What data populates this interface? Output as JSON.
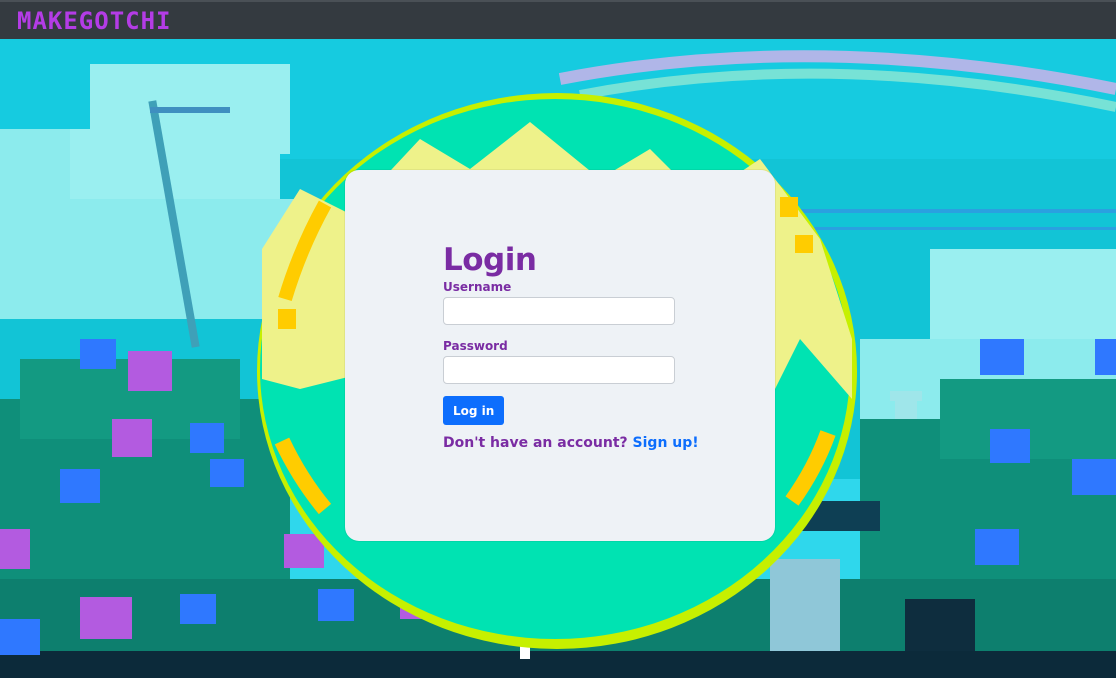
{
  "navbar": {
    "brand": "MAKEGOTCHI"
  },
  "login": {
    "title": "Login",
    "username_label": "Username",
    "username_value": "",
    "password_label": "Password",
    "password_value": "",
    "submit_label": "Log in",
    "signup_prompt": "Don't have an account?",
    "signup_link": "Sign up!"
  },
  "colors": {
    "brand": "#b43ce6",
    "accent_purple": "#7a2ca3",
    "primary_blue": "#0d6efd",
    "egg_green": "#00e0b0",
    "egg_yellow": "#eef28a"
  }
}
